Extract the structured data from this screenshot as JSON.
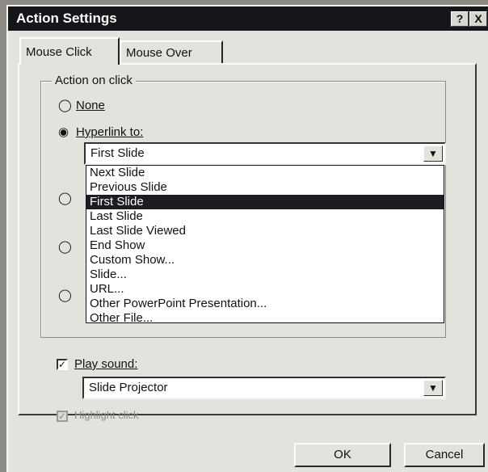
{
  "dialog": {
    "title": "Action Settings",
    "help_button": "?",
    "close_button": "X"
  },
  "tabs": [
    {
      "label": "Mouse Click"
    },
    {
      "label": "Mouse Over"
    }
  ],
  "action_group": {
    "label": "Action on click",
    "none_label": "None",
    "hyperlink_label": "Hyperlink to:",
    "hyperlink_value": "First Slide",
    "hyperlink_options": [
      "Next Slide",
      "Previous Slide",
      "First Slide",
      "Last Slide",
      "Last Slide Viewed",
      "End Show",
      "Custom Show...",
      "Slide...",
      "URL...",
      "Other PowerPoint Presentation...",
      "Other File..."
    ],
    "selected_option": "First Slide"
  },
  "sound": {
    "label": "Play sound:",
    "checked": true,
    "value": "Slide Projector"
  },
  "highlight": {
    "label": "Highlight click",
    "checked": true
  },
  "buttons": {
    "ok": "OK",
    "cancel": "Cancel"
  }
}
